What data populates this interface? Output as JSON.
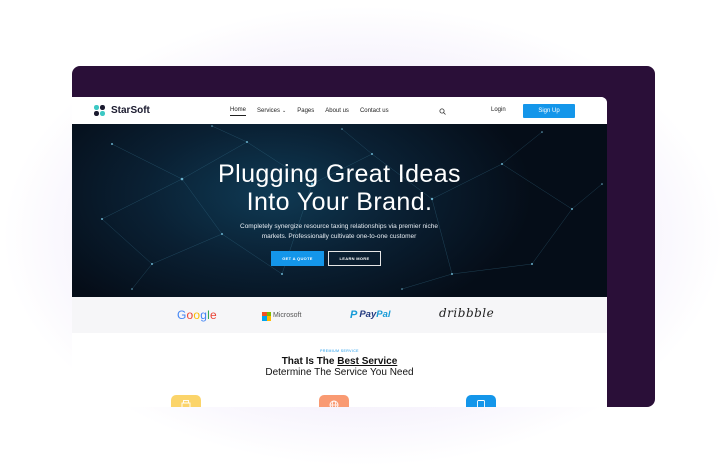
{
  "brand": {
    "name": "StarSoft",
    "logo_dot_colors": [
      "#3cc8c4",
      "#1b1b2f",
      "#1b1b2f",
      "#3cc8c4"
    ]
  },
  "nav": {
    "items": [
      {
        "label": "Home",
        "active": true
      },
      {
        "label": "Services",
        "has_caret": true
      },
      {
        "label": "Pages"
      },
      {
        "label": "About us"
      },
      {
        "label": "Contact us"
      }
    ],
    "caret_icon": "chevron-down-icon",
    "search_icon": "search-icon",
    "login_label": "Login",
    "signup_label": "Sign Up"
  },
  "hero": {
    "title_line1": "Plugging Great Ideas",
    "title_line2": "Into Your Brand.",
    "subtitle_line1": "Completely synergize resource taxing relationships via premier niche",
    "subtitle_line2": "markets. Professionally cultivate one-to-one customer",
    "primary_cta": "GET A QUOTE",
    "secondary_cta": "LEARN MORE"
  },
  "partners": {
    "google": "Google",
    "microsoft": "Microsoft",
    "paypal_pay": "Pay",
    "paypal_pal": "Pal",
    "dribbble": "dribbble"
  },
  "services": {
    "kicker": "PREMIUM SERVICE",
    "title_prefix": "That Is The ",
    "title_highlight": "Best Service",
    "subtitle": "Determine The Service You Need",
    "icons": [
      {
        "name": "printer-icon",
        "color": "#fbd46a"
      },
      {
        "name": "globe-icon",
        "color": "#f99a72"
      },
      {
        "name": "tablet-icon",
        "color": "#1496ea"
      }
    ]
  },
  "colors": {
    "accent": "#1496ea",
    "frame_dark": "#2a0f38",
    "hero_bg": "#0a2033",
    "glow": "#c9b6ee"
  }
}
